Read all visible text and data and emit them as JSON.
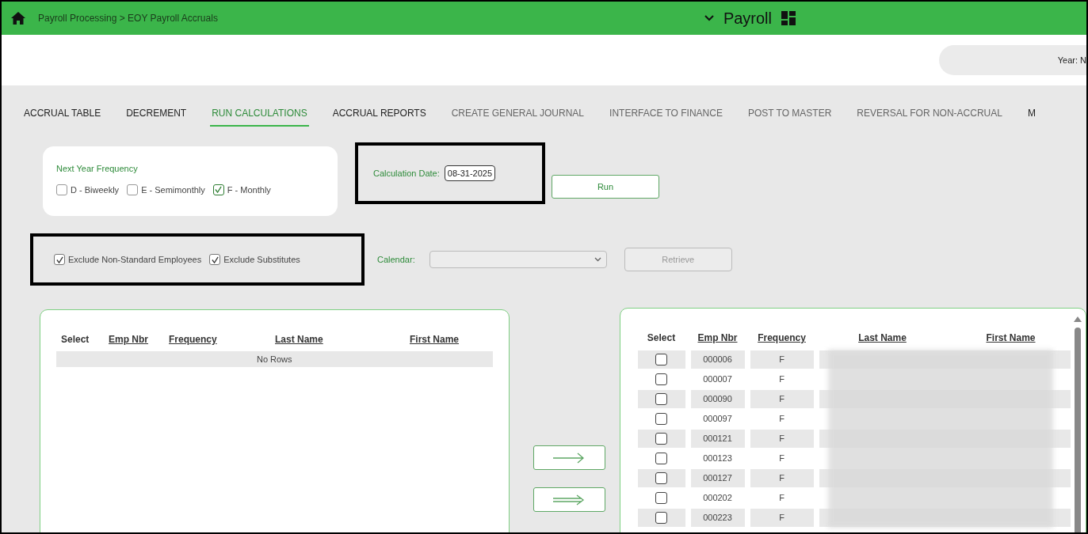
{
  "header": {
    "breadcrumb": "Payroll Processing > EOY Payroll Accruals",
    "module": "Payroll"
  },
  "year_field": {
    "label": "Year: N"
  },
  "tabs": [
    {
      "label": "ACCRUAL TABLE",
      "selected": false,
      "disabled": false
    },
    {
      "label": "DECREMENT",
      "selected": false,
      "disabled": false
    },
    {
      "label": "RUN CALCULATIONS",
      "selected": true,
      "disabled": false
    },
    {
      "label": "ACCRUAL REPORTS",
      "selected": false,
      "disabled": false
    },
    {
      "label": "CREATE GENERAL JOURNAL",
      "selected": false,
      "disabled": true
    },
    {
      "label": "INTERFACE TO FINANCE",
      "selected": false,
      "disabled": true
    },
    {
      "label": "POST TO MASTER",
      "selected": false,
      "disabled": true
    },
    {
      "label": "REVERSAL FOR NON-ACCRUAL",
      "selected": false,
      "disabled": true
    },
    {
      "label": "M",
      "selected": false,
      "disabled": false
    }
  ],
  "frequency": {
    "title": "Next Year Frequency",
    "options": [
      {
        "label": "D - Biweekly",
        "checked": false
      },
      {
        "label": "E - Semimonthly",
        "checked": false
      },
      {
        "label": "F - Monthly",
        "checked": true
      }
    ]
  },
  "calculation_date": {
    "label": "Calculation Date:",
    "value": "08-31-2025"
  },
  "run_button": "Run",
  "excludes": [
    {
      "label": "Exclude Non-Standard Employees",
      "checked": true
    },
    {
      "label": "Exclude Substitutes",
      "checked": true
    }
  ],
  "calendar": {
    "label": "Calendar:"
  },
  "retrieve_button": {
    "label": "Retrieve",
    "disabled": true
  },
  "left_table": {
    "columns": [
      "Select",
      "Emp Nbr",
      "Frequency",
      "Last Name",
      "First Name"
    ],
    "empty_text": "No Rows"
  },
  "right_table": {
    "columns": [
      "Select",
      "Emp Nbr",
      "Frequency",
      "Last Name",
      "First Name"
    ],
    "rows": [
      {
        "emp_nbr": "000006",
        "frequency": "F",
        "checked": false
      },
      {
        "emp_nbr": "000007",
        "frequency": "F",
        "checked": false
      },
      {
        "emp_nbr": "000090",
        "frequency": "F",
        "checked": false
      },
      {
        "emp_nbr": "000097",
        "frequency": "F",
        "checked": false
      },
      {
        "emp_nbr": "000121",
        "frequency": "F",
        "checked": false
      },
      {
        "emp_nbr": "000123",
        "frequency": "F",
        "checked": false
      },
      {
        "emp_nbr": "000127",
        "frequency": "F",
        "checked": false
      },
      {
        "emp_nbr": "000202",
        "frequency": "F",
        "checked": false
      },
      {
        "emp_nbr": "000223",
        "frequency": "F",
        "checked": false
      }
    ]
  }
}
